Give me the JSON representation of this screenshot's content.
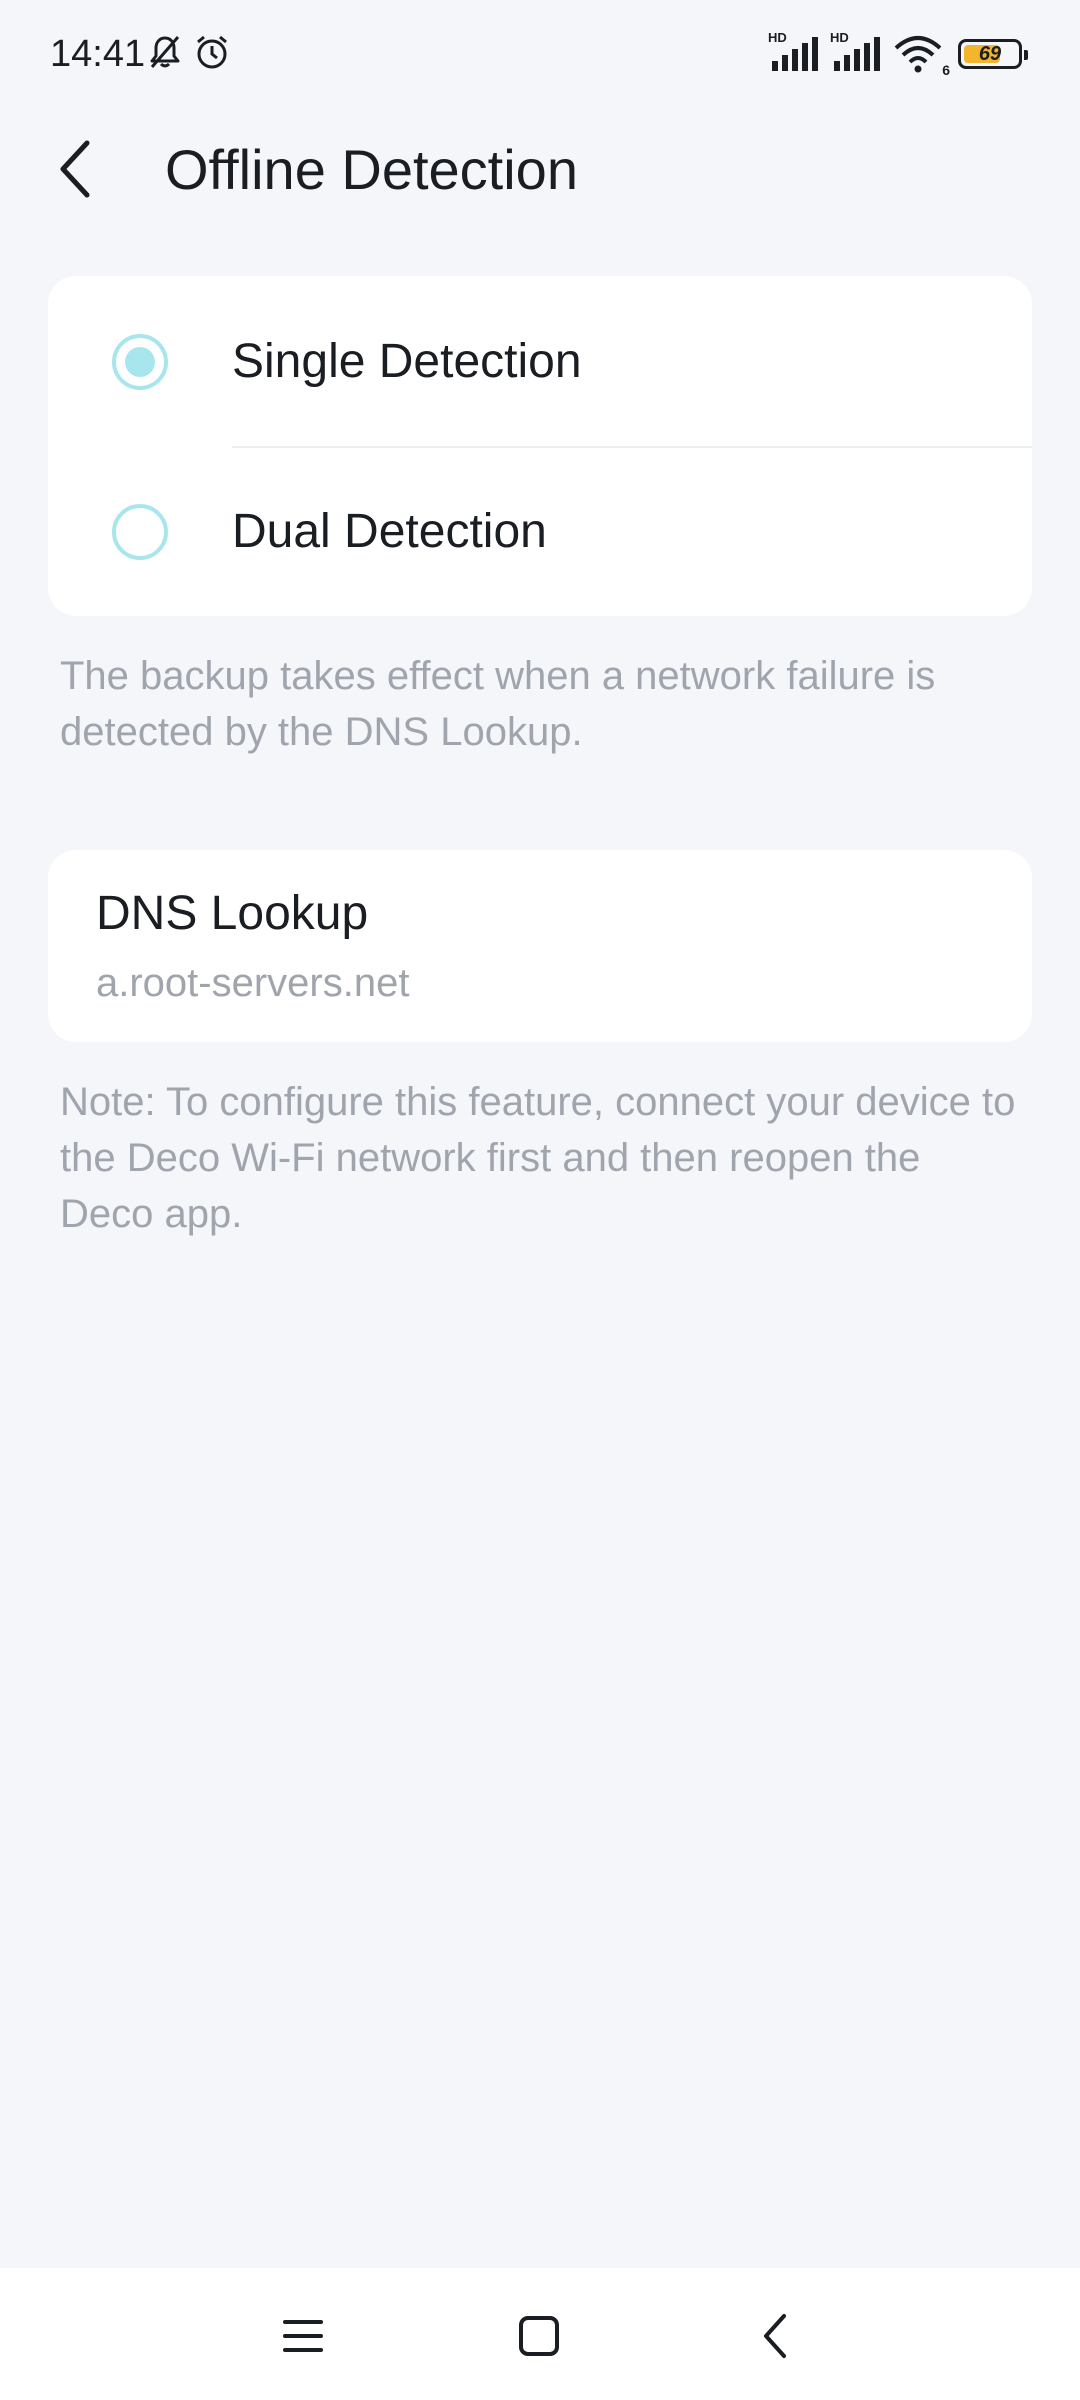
{
  "status_bar": {
    "time": "14:41",
    "signal_1_label": "HD",
    "signal_2_label": "HD",
    "wifi_label": "6",
    "battery_level": 69,
    "battery_text": "69",
    "icons": [
      "bell-off-icon",
      "alarm-icon",
      "cellular-signal-icon",
      "cellular-signal-icon",
      "wifi-icon",
      "battery-icon"
    ]
  },
  "header": {
    "title": "Offline Detection",
    "back_icon": "chevron-left-icon"
  },
  "detection": {
    "options": [
      {
        "label": "Single Detection",
        "selected": true
      },
      {
        "label": "Dual Detection",
        "selected": false
      }
    ],
    "description": "The backup takes effect when a network failure is detected by the DNS Lookup."
  },
  "dns": {
    "label": "DNS Lookup",
    "value": "a.root-servers.net"
  },
  "note": "Note: To configure this feature, connect your device to the Deco Wi-Fi network first and then reopen the Deco app.",
  "nav": {
    "icons": [
      "menu-icon",
      "home-square-icon",
      "back-triangle-icon"
    ]
  },
  "colors": {
    "background": "#f4f6fa",
    "card": "#ffffff",
    "accent": "#a8e6ee",
    "muted_text": "#a0a4ad",
    "battery": "#f3b52e"
  }
}
